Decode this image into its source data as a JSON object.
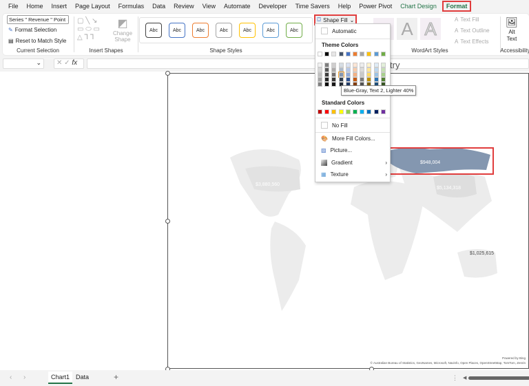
{
  "menu": [
    "File",
    "Home",
    "Insert",
    "Page Layout",
    "Formulas",
    "Data",
    "Review",
    "View",
    "Automate",
    "Developer",
    "Time Savers",
    "Help",
    "Power Pivot",
    "Chart Design",
    "Format"
  ],
  "ribbon": {
    "selection_value": "Series \" Revenue \" Point",
    "format_selection": "Format Selection",
    "reset_style": "Reset to Match Style",
    "current_selection": "Current Selection",
    "change_shape": "Change Shape",
    "insert_shapes": "Insert Shapes",
    "abc": "Abc",
    "shape_styles": "Shape Styles",
    "shape_fill": "Shape Fill",
    "text_fill": "Text Fill",
    "text_outline": "Text Outline",
    "text_effects": "Text Effects",
    "wordart_styles": "WordArt Styles",
    "alt_text": "Alt Text",
    "accessibility": "Accessibility",
    "style_colors": [
      "#404040",
      "#4472c4",
      "#ed7d31",
      "#a5a5a5",
      "#ffc000",
      "#5b9bd5",
      "#70ad47"
    ]
  },
  "formula": {
    "fx": "fx",
    "value": ""
  },
  "dropdown": {
    "automatic": "Automatic",
    "theme_colors": "Theme Colors",
    "theme_base": [
      "#ffffff",
      "#000000",
      "#e7e6e6",
      "#44546a",
      "#4472c4",
      "#ed7d31",
      "#a5a5a5",
      "#ffc000",
      "#5b9bd5",
      "#70ad47"
    ],
    "theme_tints": [
      [
        "#f2f2f2",
        "#7f7f7f",
        "#d0cece",
        "#d6dce4",
        "#d9e2f3",
        "#fbe5d5",
        "#ededed",
        "#fff2cc",
        "#deebf6",
        "#e2efd9"
      ],
      [
        "#d8d8d8",
        "#595959",
        "#aeabab",
        "#adb9ca",
        "#b4c6e7",
        "#f7cbac",
        "#dbdbdb",
        "#fee599",
        "#bdd7ee",
        "#c5e0b3"
      ],
      [
        "#bfbfbf",
        "#3f3f3f",
        "#757070",
        "#8496b0",
        "#8eaadb",
        "#f4b183",
        "#c9c9c9",
        "#ffd965",
        "#9cc3e5",
        "#a8d08d"
      ],
      [
        "#a5a5a5",
        "#262626",
        "#3a3838",
        "#323f4f",
        "#2f5496",
        "#c55a11",
        "#7b7b7b",
        "#bf9000",
        "#2e75b5",
        "#538135"
      ],
      [
        "#7f7f7f",
        "#0c0c0c",
        "#171616",
        "#222a35",
        "#1f3864",
        "#833c0b",
        "#525252",
        "#7f6000",
        "#1e4e79",
        "#375623"
      ]
    ],
    "hovered": "Blue-Gray, Text 2, Lighter 40%",
    "standard_colors_label": "Standard Colors",
    "standard": [
      "#c00000",
      "#ff0000",
      "#ffc000",
      "#ffff00",
      "#92d050",
      "#00b050",
      "#00b0f0",
      "#0070c0",
      "#002060",
      "#7030a0"
    ],
    "no_fill": "No Fill",
    "more_colors": "More Fill Colors...",
    "picture": "Picture...",
    "gradient": "Gradient",
    "texture": "Texture"
  },
  "chart": {
    "title_partial": "try",
    "labels": {
      "usa": "$3,880,560",
      "russia": "$948,004",
      "china": "$5,134,318",
      "australia": "$1,025,615"
    },
    "highlight_color": "#8497b0",
    "powered": "Powered by Bing",
    "attribution": "© Australian Bureau of Statistics, GeoNames, Microsoft, Navinfo, Open Places, OpenStreetMap, TomTom, Zenrin"
  },
  "tabs": {
    "sheets": [
      "Chart1",
      "Data"
    ],
    "active": "Chart1",
    "add": "+"
  }
}
